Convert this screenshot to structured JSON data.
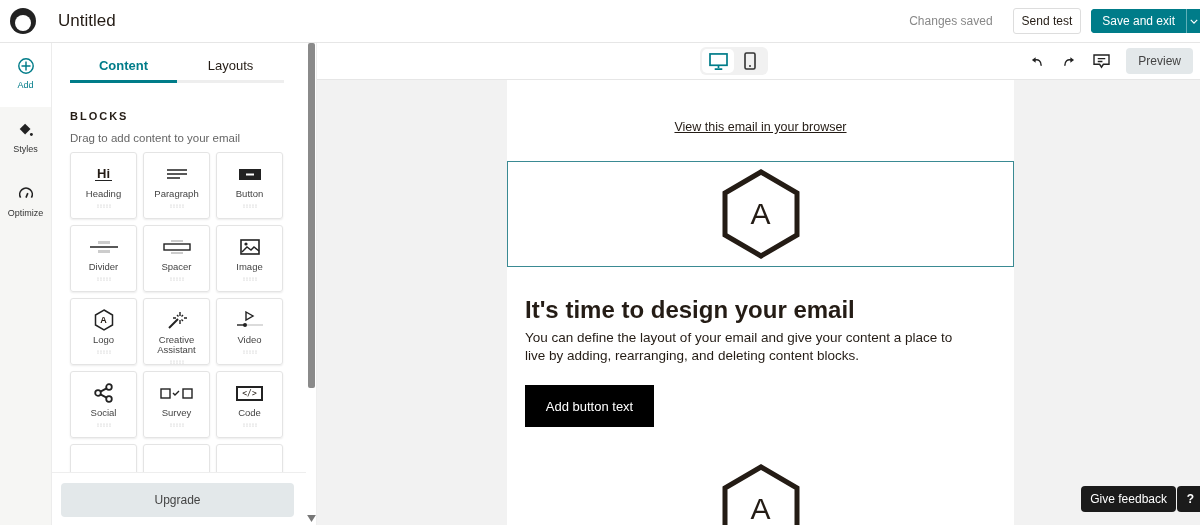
{
  "header": {
    "title": "Untitled",
    "status": "Changes saved",
    "send_test": "Send test",
    "save_exit": "Save and exit"
  },
  "rail": [
    {
      "kind": "add",
      "label": "Add",
      "selected": true
    },
    {
      "kind": "styles",
      "label": "Styles",
      "selected": false
    },
    {
      "kind": "optimize",
      "label": "Optimize",
      "selected": false
    }
  ],
  "tabs": [
    {
      "label": "Content",
      "selected": true
    },
    {
      "label": "Layouts",
      "selected": false
    }
  ],
  "blocks": {
    "heading": "BLOCKS",
    "hint": "Drag to add content to your email",
    "items": [
      {
        "kind": "heading",
        "label": "Heading",
        "icon_text": "Hi"
      },
      {
        "kind": "paragraph",
        "label": "Paragraph"
      },
      {
        "kind": "button",
        "label": "Button"
      },
      {
        "kind": "divider",
        "label": "Divider"
      },
      {
        "kind": "spacer",
        "label": "Spacer"
      },
      {
        "kind": "image",
        "label": "Image"
      },
      {
        "kind": "logo",
        "label": "Logo",
        "icon_text": "A"
      },
      {
        "kind": "creative",
        "label": "Creative Assistant"
      },
      {
        "kind": "video",
        "label": "Video"
      },
      {
        "kind": "social",
        "label": "Social"
      },
      {
        "kind": "survey",
        "label": "Survey"
      },
      {
        "kind": "code",
        "label": "Code",
        "icon_text": "</>"
      },
      {
        "kind": "partial"
      },
      {
        "kind": "partial"
      },
      {
        "kind": "partial"
      }
    ]
  },
  "upgrade": "Upgrade",
  "toolbar": {
    "devices": [
      {
        "kind": "desktop",
        "selected": true
      },
      {
        "kind": "mobile",
        "selected": false
      }
    ],
    "preview": "Preview"
  },
  "email": {
    "browser_link": "View this email in your browser",
    "blocks": [
      {
        "kind": "logo",
        "text": "A",
        "selected": true
      },
      {
        "kind": "heading",
        "text": "It's time to design your email"
      },
      {
        "kind": "paragraph",
        "text": "You can define the layout of your email and give your content a place to live by adding, rearranging, and deleting content blocks."
      },
      {
        "kind": "button",
        "text": "Add button text"
      },
      {
        "kind": "logo",
        "text": "A",
        "selected": false
      }
    ]
  },
  "feedback": "Give feedback",
  "help": "?"
}
